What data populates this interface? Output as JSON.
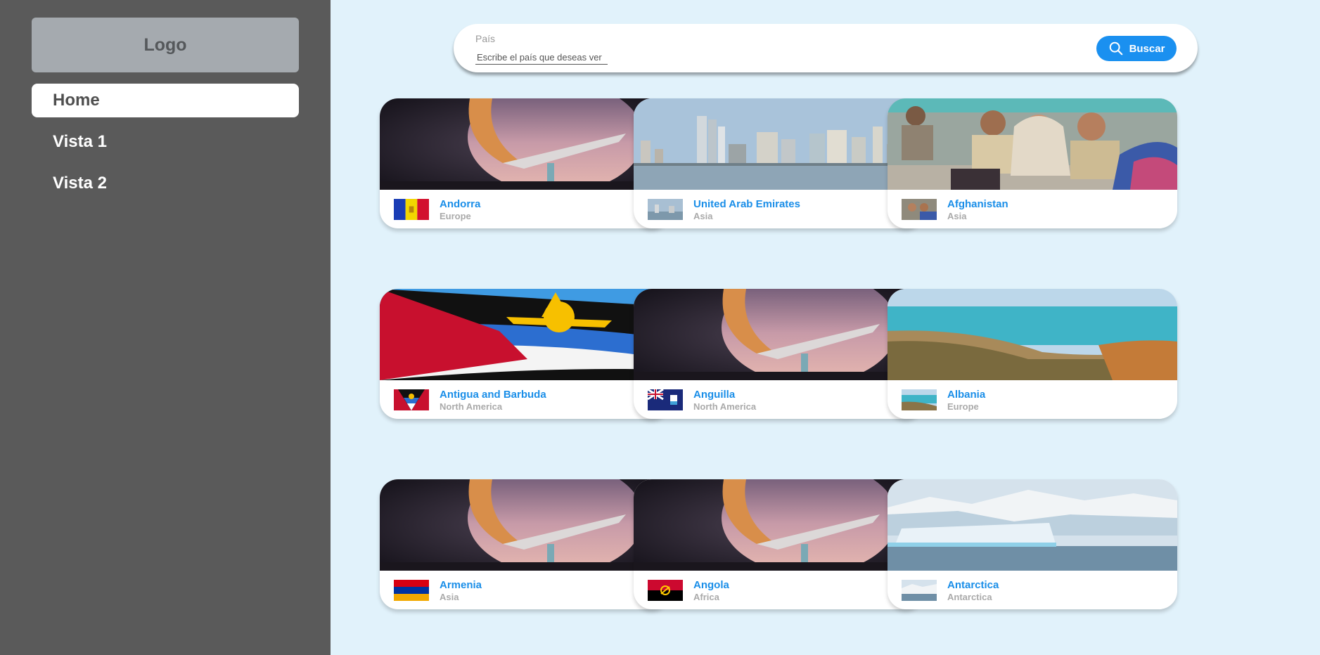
{
  "sidebar": {
    "logo": "Logo",
    "items": [
      {
        "label": "Home"
      },
      {
        "label": "Vista 1"
      },
      {
        "label": "Vista 2"
      }
    ]
  },
  "search": {
    "label": "País",
    "placeholder": "Escribe el país que deseas ver",
    "button_label": "Buscar",
    "button_icon": "search-icon"
  },
  "colors": {
    "sidebar_bg": "#5a5a5a",
    "main_bg": "#e1f2fb",
    "accent": "#1a90f0",
    "country_name": "#1a8ee8",
    "continent": "#aaaaaa"
  },
  "countries": [
    {
      "name": "Andorra",
      "continent": "Europe",
      "image": "sculpture"
    },
    {
      "name": "United Arab Emirates",
      "continent": "Asia",
      "image": "skyline"
    },
    {
      "name": "Afghanistan",
      "continent": "Asia",
      "image": "people"
    },
    {
      "name": "Antigua and Barbuda",
      "continent": "North America",
      "image": "waving-flag"
    },
    {
      "name": "Anguilla",
      "continent": "North America",
      "image": "sculpture"
    },
    {
      "name": "Albania",
      "continent": "Europe",
      "image": "coast"
    },
    {
      "name": "Armenia",
      "continent": "Asia",
      "image": "sculpture"
    },
    {
      "name": "Angola",
      "continent": "Africa",
      "image": "sculpture"
    },
    {
      "name": "Antarctica",
      "continent": "Antarctica",
      "image": "glacier"
    }
  ]
}
